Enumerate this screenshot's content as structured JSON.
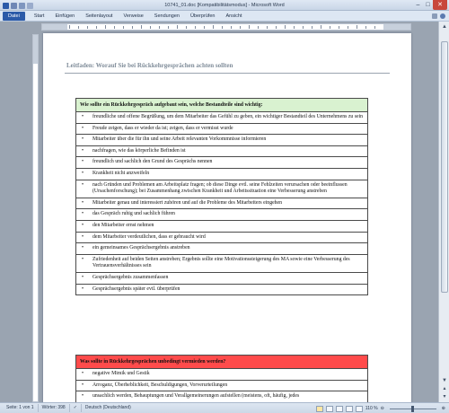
{
  "window": {
    "title": "10741_01.doc [Kompatibilitätsmodus] - Microsoft Word",
    "minimize": "–",
    "maximize": "□",
    "close": "✕"
  },
  "ribbon": {
    "tabs": [
      "Datei",
      "Start",
      "Einfügen",
      "Seitenlayout",
      "Verweise",
      "Sendungen",
      "Überprüfen",
      "Ansicht"
    ]
  },
  "document": {
    "heading": "Leitfaden: Worauf Sie bei Rückkehrgesprächen achten sollten",
    "table1": {
      "header": "Wie sollte ein Rückkehrgespräch aufgebaut sein, welche Bestandteile sind wichtig:",
      "header_color": "#d9f2d0",
      "items": [
        "freundliche und offene Begrüßung, um dem Mitarbeiter das Gefühl zu geben, ein wichtiger Bestandteil des Unternehmens zu sein",
        "Freude zeigen, dass er wieder da ist; zeigen, dass er vermisst wurde",
        "Mitarbeiter über die für ihn und seine Arbeit relevanten Vorkommnisse informieren",
        "nachfragen, wie das körperliche Befinden ist",
        "freundlich und sachlich den Grund des Gesprächs nennen",
        "Krankheit nicht anzweifeln",
        "nach Gründen und Problemen am Arbeitsplatz fragen; ob diese Dinge evtl. seine Fehlzeiten verursachen oder beeinflussen (Ursachenforschung); bei Zusammenhang zwischen Krankheit und Arbeitssituation eine Verbesserung anstreben",
        "Mitarbeiter genau und interessiert zuhören und auf die Probleme des Mitarbeiters eingehen",
        "das Gespräch ruhig und sachlich führen",
        "den Mitarbeiter ernst nehmen",
        "dem Mitarbeiter verdeutlichen, dass er gebraucht wird",
        "ein gemeinsames Gesprächsergebnis anstreben",
        "Zufriedenheit auf beiden Seiten anstreben; Ergebnis sollte eine Motivationssteigerung des MA sowie eine Verbesserung des Vertrauensverhältnisses sein",
        "Gesprächsergebnis zusammenfassen",
        "Gesprächsergebnis später evtl. überprüfen"
      ]
    },
    "table2": {
      "header": "Was sollte in Rückkehrgesprächen unbedingt vermieden werden?",
      "header_color": "#ff4b4b",
      "items": [
        "negative Mimik und Gestik",
        "Arroganz, Überheblichkeit, Beschuldigungen, Vorverurteilungen",
        "unsachlich werden, Behauptungen und Verallgemeinerungen aufstellen (meistens, oft, häufig, jedes"
      ]
    }
  },
  "statusbar": {
    "page": "Seite: 1 von 1",
    "words": "Wörter: 398",
    "language": "Deutsch (Deutschland)",
    "zoom": "110 %"
  }
}
